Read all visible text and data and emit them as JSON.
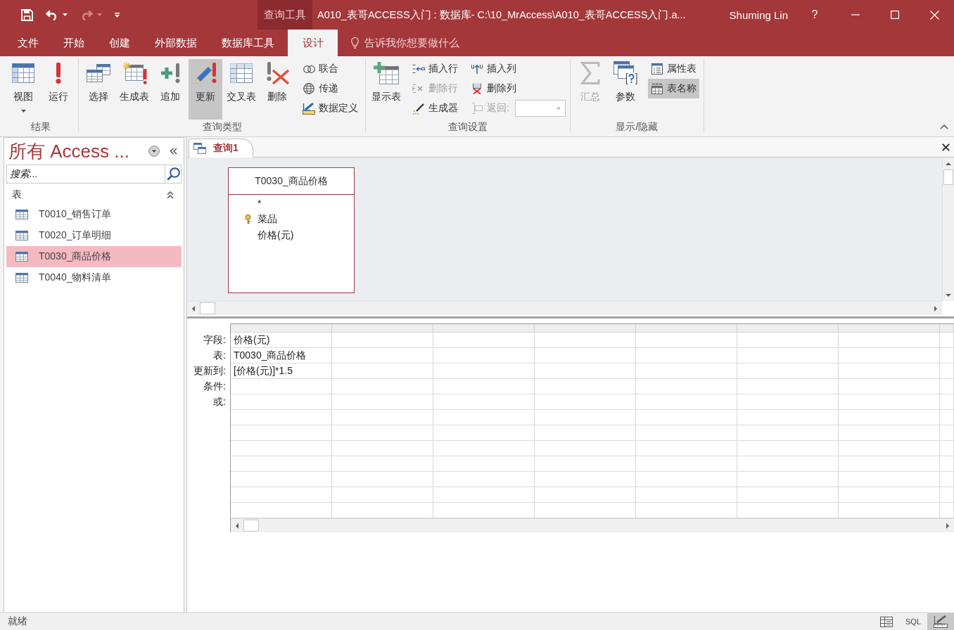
{
  "title_bar": {
    "quick_access": [
      {
        "kind": "save",
        "disabled": false
      },
      {
        "kind": "undo",
        "disabled": false
      },
      {
        "kind": "redo",
        "disabled": true
      },
      {
        "kind": "customize",
        "disabled": false
      }
    ],
    "context_label": "查询工具",
    "title": "A010_表哥ACCESS入门 : 数据库- C:\\10_MrAccess\\A010_表哥ACCESS入门.a...",
    "user": "Shuming Lin",
    "help": "?"
  },
  "ribbon_tabs": [
    {
      "label": "文件",
      "selected": false
    },
    {
      "label": "开始",
      "selected": false
    },
    {
      "label": "创建",
      "selected": false
    },
    {
      "label": "外部数据",
      "selected": false
    },
    {
      "label": "数据库工具",
      "selected": false
    },
    {
      "label": "设计",
      "selected": true
    }
  ],
  "tell_me": {
    "placeholder": "告诉我你想要做什么"
  },
  "ribbon": {
    "groups": [
      {
        "label": "结果",
        "buttons": [
          {
            "kind": "large",
            "label": "视图",
            "selected": false,
            "disabled": false
          },
          {
            "kind": "large",
            "label": "运行",
            "selected": false,
            "disabled": false
          }
        ]
      },
      {
        "label": "查询类型",
        "buttons": [
          {
            "kind": "large",
            "label": "选择",
            "selected": false,
            "disabled": false
          },
          {
            "kind": "large",
            "label": "生成表",
            "selected": false,
            "disabled": false
          },
          {
            "kind": "large",
            "label": "追加",
            "selected": false,
            "disabled": false
          },
          {
            "kind": "large",
            "label": "更新",
            "selected": true,
            "disabled": false
          },
          {
            "kind": "large",
            "label": "交叉表",
            "selected": false,
            "disabled": false
          },
          {
            "kind": "large",
            "label": "删除",
            "selected": false,
            "disabled": false
          },
          {
            "kind": "small",
            "label": "联合",
            "selected": false,
            "disabled": false
          },
          {
            "kind": "small",
            "label": "传递",
            "selected": false,
            "disabled": false
          },
          {
            "kind": "small",
            "label": "数据定义",
            "selected": false,
            "disabled": false
          }
        ]
      },
      {
        "label": "查询设置",
        "buttons": [
          {
            "kind": "large",
            "label": "显示表",
            "selected": false,
            "disabled": false
          },
          {
            "kind": "small",
            "label": "插入行",
            "selected": false,
            "disabled": false
          },
          {
            "kind": "small",
            "label": "删除行",
            "selected": false,
            "disabled": true
          },
          {
            "kind": "small",
            "label": "生成器",
            "selected": false,
            "disabled": false
          },
          {
            "kind": "small",
            "label": "插入列",
            "selected": false,
            "disabled": false
          },
          {
            "kind": "small",
            "label": "删除列",
            "selected": false,
            "disabled": false
          },
          {
            "kind": "combo",
            "label": "返回:",
            "selected": false,
            "disabled": true
          }
        ]
      },
      {
        "label": "显示/隐藏",
        "buttons": [
          {
            "kind": "large",
            "label": "汇总",
            "selected": false,
            "disabled": true
          },
          {
            "kind": "large",
            "label": "参数",
            "selected": false,
            "disabled": false
          },
          {
            "kind": "small",
            "label": "属性表",
            "selected": false,
            "disabled": false
          },
          {
            "kind": "small",
            "label": "表名称",
            "selected": true,
            "disabled": false
          }
        ]
      }
    ]
  },
  "nav_pane": {
    "title": "所有 Access ...",
    "search": {
      "placeholder": "搜索..."
    },
    "groups": [
      {
        "label": "表",
        "expanded": true,
        "items": [
          {
            "label": "T0010_销售订单",
            "selected": false
          },
          {
            "label": "T0020_订单明细",
            "selected": false
          },
          {
            "label": "T0030_商品价格",
            "selected": true
          },
          {
            "label": "T0040_物料清单",
            "selected": false
          }
        ]
      }
    ]
  },
  "document": {
    "tabs": [
      {
        "label": "查询1",
        "selected": true
      }
    ],
    "field_lists": [
      {
        "title": "T0030_商品价格",
        "fields": [
          {
            "label": "*",
            "primary_key": false
          },
          {
            "label": "菜品",
            "primary_key": true
          },
          {
            "label": "价格(元)",
            "primary_key": false
          }
        ]
      }
    ],
    "grid": {
      "row_labels": [
        "字段:",
        "表:",
        "更新到:",
        "条件:",
        "或:"
      ],
      "columns": [
        {
          "cells": [
            "价格(元)",
            "T0030_商品价格",
            "[价格(元)]*1.5"
          ]
        }
      ]
    }
  },
  "status_bar": {
    "text": "就绪",
    "views": [
      {
        "kind": "datasheet",
        "selected": false
      },
      {
        "kind": "sql",
        "label": "SQL",
        "selected": false
      },
      {
        "kind": "design",
        "selected": true
      }
    ]
  }
}
